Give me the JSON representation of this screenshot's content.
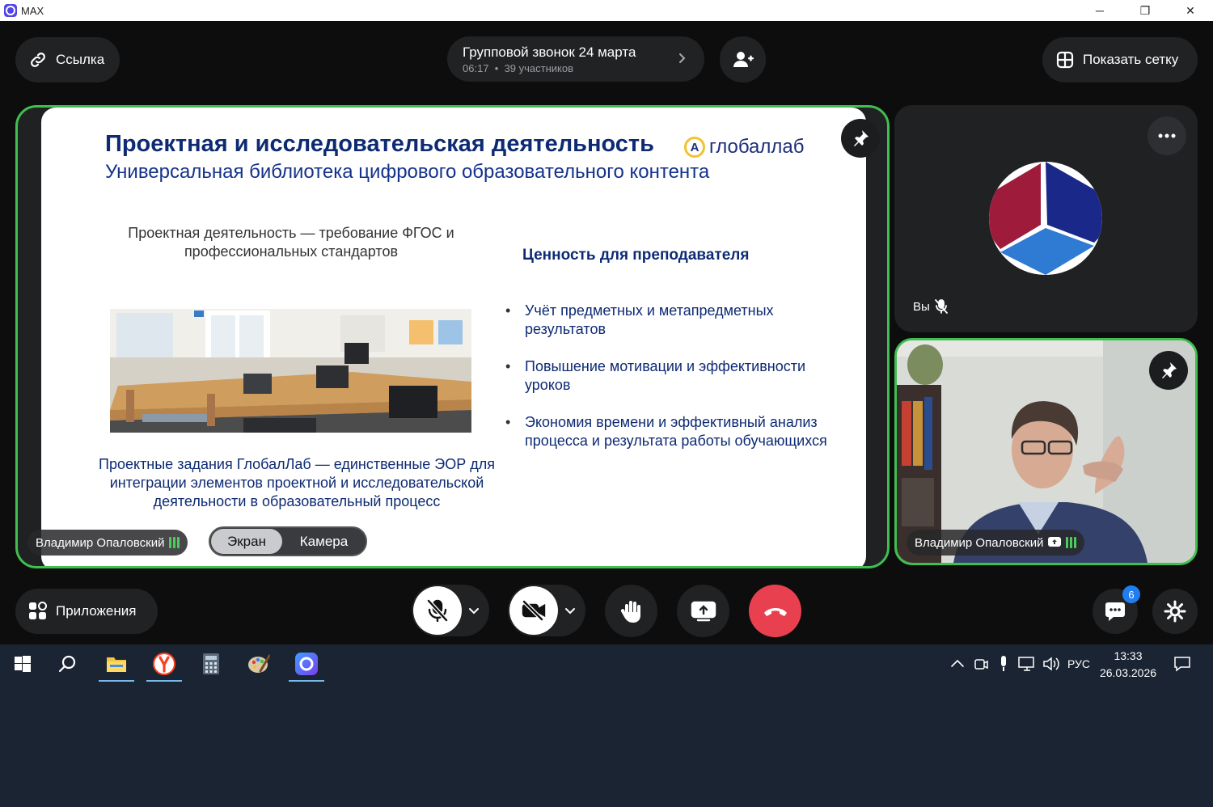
{
  "window": {
    "title": "MAX",
    "minimize_icon": "─",
    "restore_icon": "❐",
    "close_icon": "✕"
  },
  "header": {
    "link_label": "Ссылка",
    "call_title": "Групповой звонок 24 марта",
    "call_time": "06:17",
    "call_separator": "•",
    "call_participants": "39 участников",
    "grid_label": "Показать сетку"
  },
  "slide": {
    "title": "Проектная и исследовательская деятельность",
    "subtitle": "Универсальная библиотека цифрового образовательного контента",
    "logo_text": "глобаллаб",
    "left_top": "Проектная деятельность — требование ФГОС и профессиональных стандартов",
    "left_bottom": "Проектные задания ГлобалЛаб — единственные ЭОР для интеграции элементов проектной и исследовательской деятельности в образовательный процесс",
    "right_heading": "Ценность для преподавателя",
    "bullets": [
      "Учёт предметных и метапредметных результатов",
      "Повышение мотивации и эффективности уроков",
      "Экономия времени и эффективный анализ процесса и результата работы обучающихся"
    ]
  },
  "main_tile": {
    "speaker_name": "Владимир Опаловский",
    "seg_screen": "Экран",
    "seg_camera": "Камера"
  },
  "you_tile": {
    "label": "Вы"
  },
  "cam_tile": {
    "speaker_name": "Владимир Опаловский"
  },
  "controls": {
    "apps_label": "Приложения",
    "chat_badge": "6"
  },
  "taskbar": {
    "language": "РУС",
    "time": "13:33",
    "date": "26.03.2026"
  },
  "colors": {
    "accent_green": "#3fbf4f",
    "end_call_red": "#e8404f",
    "badge_blue": "#1f7ef0",
    "slide_navy": "#0d2a73"
  }
}
